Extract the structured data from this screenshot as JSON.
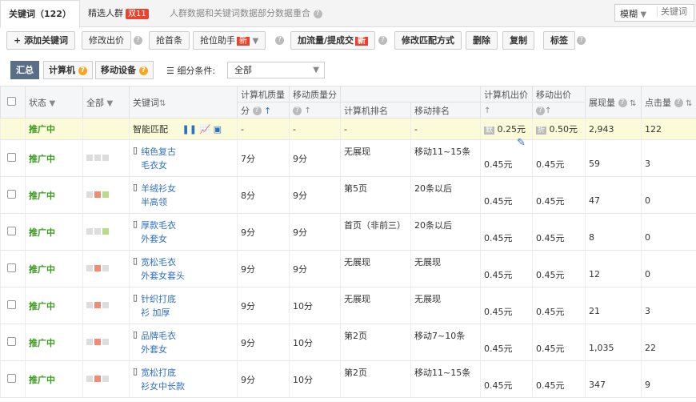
{
  "tabs": {
    "keyword": "关键词（122）",
    "crowd": "精选人群",
    "crowd_badge": "双11",
    "info": "人群数据和关键词数据部分数据重合"
  },
  "search": {
    "mode": "模糊",
    "placeholder": "关键词"
  },
  "toolbar": {
    "add": "添加关键词",
    "bid": "修改出价",
    "first": "抢首条",
    "rank": "抢位助手",
    "rank_badge": "新",
    "traffic": "加流量/提成交",
    "traffic_badge": "新",
    "match": "修改匹配方式",
    "delete": "删除",
    "copy": "复制",
    "tag": "标签"
  },
  "segments": {
    "all": "汇总",
    "pc": "计算机",
    "mobile": "移动设备"
  },
  "filter": {
    "label": "细分条件:",
    "value": "全部"
  },
  "table": {
    "headers": {
      "status": "状态",
      "all": "全部",
      "keyword": "关键词",
      "pc_quality_1": "计算机质量",
      "pc_quality_2": "分",
      "mobile_quality": "移动质量分",
      "pc_rank": "计算机排名",
      "mobile_rank": "移动排名",
      "pc_bid": "计算机出价",
      "mobile_bid": "移动出价",
      "impressions": "展现量",
      "clicks": "点击量"
    },
    "smart_row": {
      "status": "推广中",
      "keyword": "智能匹配",
      "pc_quality": "-",
      "mobile_quality": "-",
      "pc_rank": "-",
      "mobile_rank": "-",
      "pc_bid_tag": "默",
      "pc_bid": "0.25元",
      "mobile_bid_tag": "折",
      "mobile_bid": "0.50元",
      "impressions": "2,943",
      "clicks": "122"
    },
    "rows": [
      {
        "status": "推广中",
        "kw1": "纯色复古",
        "kw2": "毛衣女",
        "pcq": "7分",
        "mq": "9分",
        "pcr": "无展现",
        "mr": "移动11~15条",
        "pcb": "0.45元",
        "mb": "0.45元",
        "imp": "59",
        "clk": "3",
        "sq": [
          "",
          "",
          ""
        ]
      },
      {
        "status": "推广中",
        "kw1": "羊绒衫女",
        "kw2": "半高领",
        "pcq": "8分",
        "mq": "9分",
        "pcr": "第5页",
        "mr": "20条以后",
        "pcb": "0.45元",
        "mb": "0.45元",
        "imp": "47",
        "clk": "0",
        "sq": [
          "",
          "red",
          "green"
        ]
      },
      {
        "status": "推广中",
        "kw1": "厚款毛衣",
        "kw2": "外套女",
        "pcq": "9分",
        "mq": "9分",
        "pcr": "首页（非前三）",
        "mr": "20条以后",
        "pcb": "0.45元",
        "mb": "0.45元",
        "imp": "8",
        "clk": "0",
        "sq": [
          "",
          "",
          "green"
        ]
      },
      {
        "status": "推广中",
        "kw1": "宽松毛衣",
        "kw2": "外套女套头",
        "pcq": "9分",
        "mq": "9分",
        "pcr": "无展现",
        "mr": "无展现",
        "pcb": "0.45元",
        "mb": "0.45元",
        "imp": "12",
        "clk": "0",
        "sq": [
          "",
          "red",
          ""
        ]
      },
      {
        "status": "推广中",
        "kw1": "针织打底",
        "kw2": "衫 加厚",
        "pcq": "9分",
        "mq": "10分",
        "pcr": "无展现",
        "mr": "无展现",
        "pcb": "0.45元",
        "mb": "0.45元",
        "imp": "21",
        "clk": "3",
        "sq": [
          "",
          "red",
          ""
        ]
      },
      {
        "status": "推广中",
        "kw1": "品牌毛衣",
        "kw2": "外套女",
        "pcq": "9分",
        "mq": "10分",
        "pcr": "第2页",
        "mr": "移动7~10条",
        "pcb": "0.45元",
        "mb": "0.45元",
        "imp": "1,035",
        "clk": "22",
        "sq": [
          "",
          "red",
          ""
        ]
      },
      {
        "status": "推广中",
        "kw1": "宽松打底",
        "kw2": "衫女中长款",
        "pcq": "9分",
        "mq": "10分",
        "pcr": "第2页",
        "mr": "移动11~15条",
        "pcb": "0.45元",
        "mb": "0.45元",
        "imp": "347",
        "clk": "9",
        "sq": [
          "",
          "red",
          ""
        ]
      }
    ]
  }
}
